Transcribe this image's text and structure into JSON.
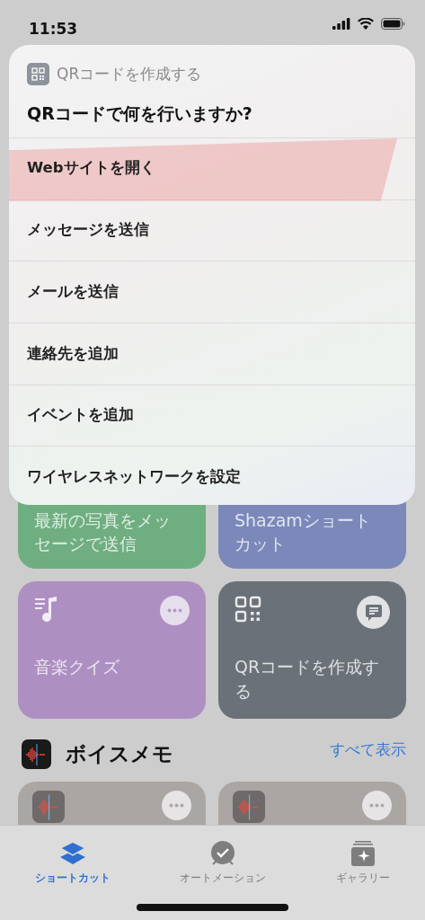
{
  "status_bar": {
    "time": "11:53"
  },
  "sheet": {
    "app_name": "QRコードを作成する",
    "question": "QRコードで何を行いますか?",
    "options": [
      {
        "label": "Webサイトを開く",
        "highlighted": true
      },
      {
        "label": "メッセージを送信",
        "highlighted": false
      },
      {
        "label": "メールを送信",
        "highlighted": false
      },
      {
        "label": "連絡先を追加",
        "highlighted": false
      },
      {
        "label": "イベントを追加",
        "highlighted": false
      },
      {
        "label": "ワイヤレスネットワークを設定",
        "highlighted": false
      }
    ]
  },
  "shortcuts": [
    {
      "title": "最新の写真をメッセージで送信",
      "color": "#6fae80",
      "kind": "plain"
    },
    {
      "title": "Shazamショートカット",
      "color": "#7b88b9",
      "kind": "plain"
    },
    {
      "title": "音楽クイズ",
      "color": "#ae8fc2",
      "kind": "music"
    },
    {
      "title": "QRコードを作成する",
      "color": "#6b7178",
      "kind": "qr"
    }
  ],
  "section": {
    "title": "ボイスメモ",
    "link": "すべて表示"
  },
  "tabs": [
    {
      "label": "ショートカット",
      "selected": true
    },
    {
      "label": "オートメーション",
      "selected": false
    },
    {
      "label": "ギャラリー",
      "selected": false
    }
  ]
}
